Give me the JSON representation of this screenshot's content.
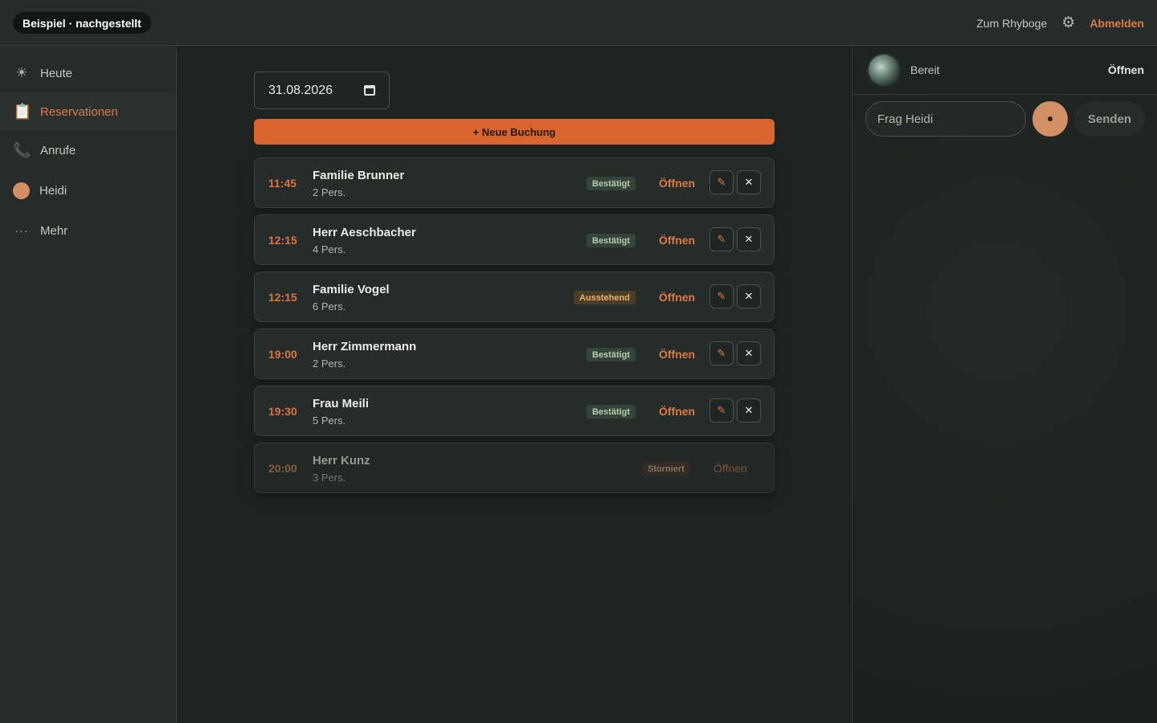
{
  "header": {
    "brand": "Beispiel · nachgestellt",
    "link": "Zum Rhyboge",
    "logout": "Abmelden"
  },
  "sidebar": {
    "items": [
      {
        "label": "Heute",
        "icon": "sun-icon"
      },
      {
        "label": "Reservationen",
        "icon": "clipboard-icon",
        "active": true
      },
      {
        "label": "Anrufe",
        "icon": "phone-icon"
      },
      {
        "label": "Heidi",
        "icon": "avatar-dot-icon"
      },
      {
        "label": "Mehr",
        "icon": "more-dots-icon"
      }
    ]
  },
  "main": {
    "date": "31.08.2026",
    "new_booking": "+ Neue Buchung",
    "open_label": "Öffnen",
    "reservations": [
      {
        "time": "11:45",
        "name": "Familie Brunner",
        "persons": "2 Pers.",
        "status": "Bestätigt",
        "status_type": "ok"
      },
      {
        "time": "12:15",
        "name": "Herr Aeschbacher",
        "persons": "4 Pers.",
        "status": "Bestätigt",
        "status_type": "ok"
      },
      {
        "time": "12:15",
        "name": "Familie Vogel",
        "persons": "6 Pers.",
        "status": "Ausstehend",
        "status_type": "pending"
      },
      {
        "time": "19:00",
        "name": "Herr Zimmermann",
        "persons": "2 Pers.",
        "status": "Bestätigt",
        "status_type": "ok"
      },
      {
        "time": "19:30",
        "name": "Frau Meili",
        "persons": "5 Pers.",
        "status": "Bestätigt",
        "status_type": "ok"
      },
      {
        "time": "20:00",
        "name": "Herr Kunz",
        "persons": "3 Pers.",
        "status": "Storniert",
        "status_type": "cancel"
      }
    ]
  },
  "assistant": {
    "status": "Bereit",
    "open": "Öffnen",
    "input_placeholder": "Frag Heidi",
    "send": "Senden"
  },
  "colors": {
    "accent": "#e07a45",
    "button": "#d9642d",
    "background": "#1c2320",
    "panel": "#262c2a"
  }
}
